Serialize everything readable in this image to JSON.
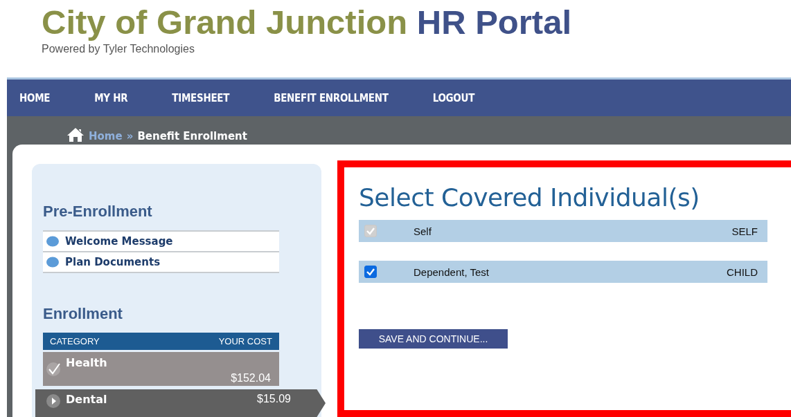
{
  "header": {
    "title": "City of Grand Junction",
    "title_accent": "HR Portal",
    "subtitle": "Powered by Tyler Technologies"
  },
  "nav": [
    "HOME",
    "MY HR",
    "TIMESHEET",
    "BENEFIT ENROLLMENT",
    "LOGOUT"
  ],
  "breadcrumb": {
    "home": "Home",
    "separator": "»",
    "current": "Benefit Enrollment"
  },
  "sidebar": {
    "pre_enrollment": {
      "title": "Pre-Enrollment",
      "items": [
        "Welcome Message",
        "Plan Documents"
      ]
    },
    "enrollment": {
      "title": "Enrollment",
      "columns": [
        "CATEGORY",
        "YOUR COST"
      ],
      "rows": [
        {
          "category": "Health",
          "cost": "$152.04",
          "completed": true,
          "selected": false
        },
        {
          "category": "Dental",
          "cost": "$15.09",
          "completed": false,
          "selected": true
        }
      ]
    }
  },
  "main": {
    "title": "Select Covered Individual(s)",
    "individuals": [
      {
        "name": "Self",
        "relationship": "SELF",
        "checked": true,
        "disabled": true
      },
      {
        "name": "Dependent, Test",
        "relationship": "CHILD",
        "checked": true,
        "disabled": false
      }
    ],
    "button": "SAVE AND CONTINUE..."
  }
}
